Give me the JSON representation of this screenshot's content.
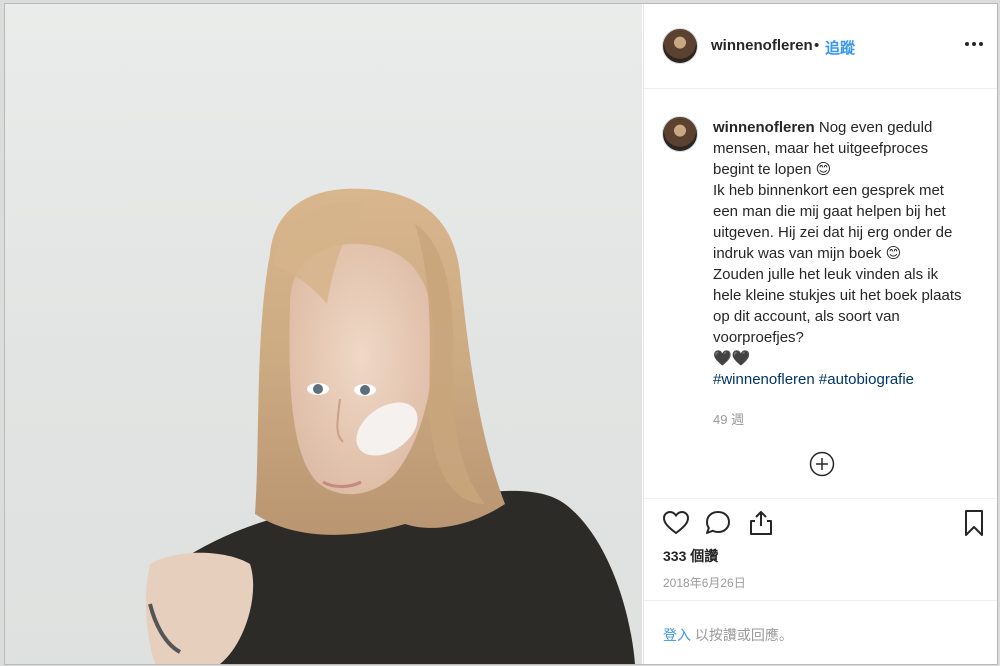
{
  "post": {
    "photo_alt": "portrait photo",
    "header": {
      "username": "winnenofleren",
      "separator": "•",
      "follow_label": "追蹤"
    },
    "caption": {
      "username": "winnenofleren",
      "lines": [
        "Nog even geduld",
        "mensen, maar het uitgeefproces",
        "begint te lopen 😊",
        "Ik heb binnenkort een gesprek met",
        "een man die mij gaat helpen bij het",
        "uitgeven. Hij zei dat hij erg onder de",
        "indruk was van mijn boek 😊",
        "Zouden julle het leuk vinden als ik",
        "hele kleine stukjes uit het boek plaats",
        "op dit account, als soort van",
        "voorproefjes?",
        "🖤🖤"
      ],
      "hashtags": [
        "#winnenofleren",
        "#autobiografie"
      ],
      "time_ago": "49 週"
    },
    "actions": {
      "like_icon": "heart-icon",
      "comment_icon": "comment-icon",
      "share_icon": "share-icon",
      "save_icon": "bookmark-icon"
    },
    "likes": "333 個讚",
    "date": "2018年6月26日",
    "login_prompt": {
      "link": "登入",
      "text": "以按讚或回應。"
    }
  },
  "colors": {
    "accent": "#3897f0",
    "hashtag": "#003569",
    "muted": "#999999"
  }
}
